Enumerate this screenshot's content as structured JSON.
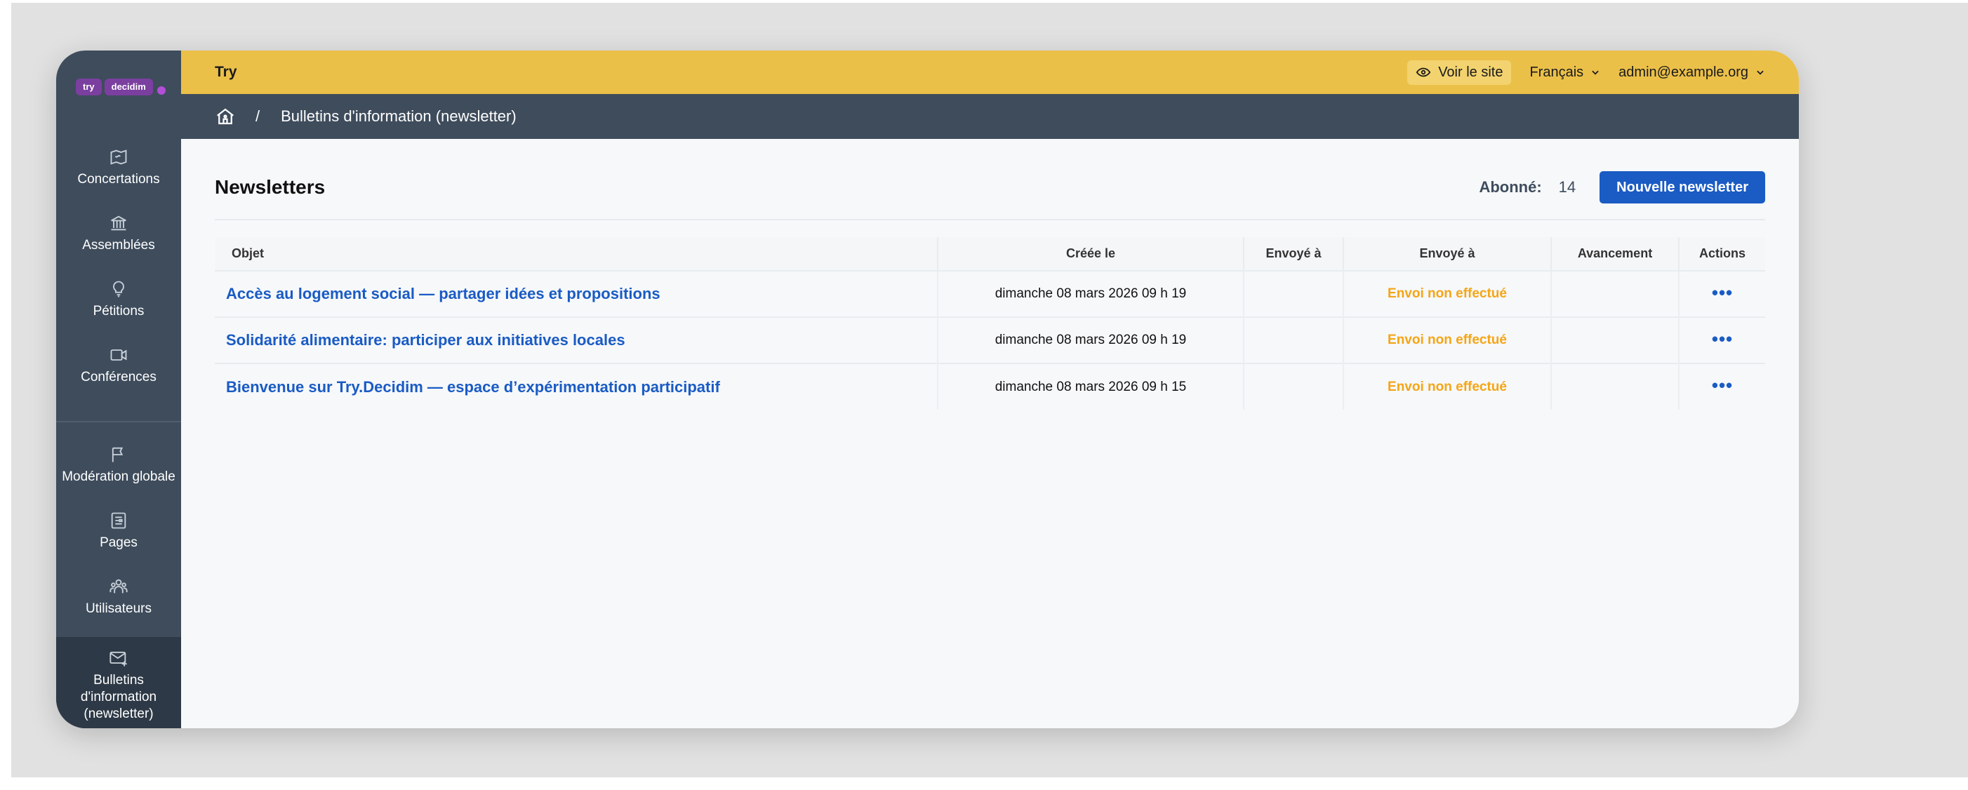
{
  "logo": {
    "word1": "try",
    "word2": "decidim"
  },
  "sidebar": {
    "items": [
      {
        "label": "Concertations",
        "icon": "map-icon"
      },
      {
        "label": "Assemblées",
        "icon": "building-icon"
      },
      {
        "label": "Pétitions",
        "icon": "lightbulb-icon"
      },
      {
        "label": "Conférences",
        "icon": "video-icon"
      },
      {
        "label": "Modération globale",
        "icon": "flag-icon"
      },
      {
        "label": "Pages",
        "icon": "page-icon"
      },
      {
        "label": "Utilisateurs",
        "icon": "users-icon"
      },
      {
        "label": "Bulletins d'information (newsletter)",
        "icon": "mail-add-icon",
        "active": true
      }
    ]
  },
  "topbar": {
    "org_name": "Try",
    "view_site": "Voir le site",
    "language": "Français",
    "user": "admin@example.org"
  },
  "breadcrumb": {
    "current": "Bulletins d'information (newsletter)"
  },
  "main": {
    "title": "Newsletters",
    "subscribers_label": "Abonné:",
    "subscribers_count": "14",
    "new_button": "Nouvelle newsletter"
  },
  "table": {
    "headers": [
      "Objet",
      "Créée le",
      "Envoyé à",
      "Envoyé à",
      "Avancement",
      "Actions"
    ],
    "rows": [
      {
        "subject": "Accès au logement social — partager idées et propositions",
        "created": "dimanche 08 mars 2026 09 h 19",
        "sent_to": "",
        "status": "Envoi non effectué",
        "progress": "",
        "actions": "•••"
      },
      {
        "subject": "Solidarité alimentaire: participer aux initiatives locales",
        "created": "dimanche 08 mars 2026 09 h 19",
        "sent_to": "",
        "status": "Envoi non effectué",
        "progress": "",
        "actions": "•••"
      },
      {
        "subject": "Bienvenue sur Try.Decidim — espace d’expérimentation participatif",
        "created": "dimanche 08 mars 2026 09 h 15",
        "sent_to": "",
        "status": "Envoi non effectué",
        "progress": "",
        "actions": "•••"
      }
    ]
  },
  "colors": {
    "topbar": "#ebc049",
    "sidebar": "#3e4c5c",
    "link": "#1a5bc4",
    "status_pending": "#f5a515"
  }
}
